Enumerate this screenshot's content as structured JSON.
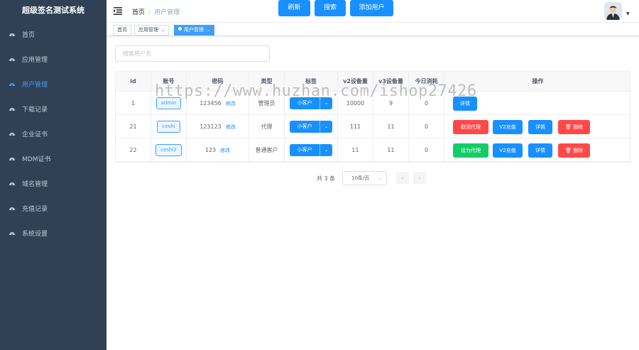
{
  "app": {
    "title": "超级签名测试系统"
  },
  "sidebar": {
    "items": [
      {
        "label": "首页",
        "icon": "dashboard-icon",
        "active": false
      },
      {
        "label": "应用管理",
        "icon": "dashboard-icon",
        "active": false
      },
      {
        "label": "用户管理",
        "icon": "dashboard-icon",
        "active": true
      },
      {
        "label": "下载记录",
        "icon": "dashboard-icon",
        "active": false
      },
      {
        "label": "企业证书",
        "icon": "dashboard-icon",
        "active": false
      },
      {
        "label": "MDM证书",
        "icon": "dashboard-icon",
        "active": false
      },
      {
        "label": "域名管理",
        "icon": "dashboard-icon",
        "active": false
      },
      {
        "label": "充值记录",
        "icon": "dashboard-icon",
        "active": false
      },
      {
        "label": "系统设置",
        "icon": "dashboard-icon",
        "active": false
      }
    ]
  },
  "header": {
    "breadcrumb": {
      "home": "首页",
      "separator": "/",
      "current": "用户管理"
    }
  },
  "tags": [
    {
      "label": "首页",
      "active": false
    },
    {
      "label": "应用管理",
      "active": false
    },
    {
      "label": "用户管理",
      "active": true
    }
  ],
  "toolbar": {
    "search_placeholder": "搜索用户名",
    "refresh_label": "刷新",
    "search_label": "搜索",
    "add_user_label": "添加用户"
  },
  "table": {
    "columns": [
      "id",
      "账号",
      "密码",
      "类型",
      "标签",
      "v2设备量",
      "v3设备量",
      "今日消耗",
      "操作"
    ],
    "modify_label": "修改",
    "rows": [
      {
        "id": "1",
        "account": "admin",
        "password": "123456",
        "type": "管理员",
        "tag": "小客户",
        "v2": "10000",
        "v3": "9",
        "today": "0",
        "actions": [
          "详情"
        ]
      },
      {
        "id": "21",
        "account": "ceshi",
        "password": "123123",
        "type": "代理",
        "tag": "小客户",
        "v2": "111",
        "v3": "11",
        "today": "0",
        "actions": [
          "取消代理",
          "V2充值",
          "详情",
          "删除"
        ]
      },
      {
        "id": "22",
        "account": "ceshi2",
        "password": "123",
        "type": "普通客户",
        "tag": "小客户",
        "v2": "11",
        "v3": "11",
        "today": "0",
        "actions": [
          "设为代理",
          "V2充值",
          "详情",
          "删除"
        ]
      }
    ]
  },
  "pagination": {
    "total_text": "共 3 条",
    "page_size": "10条/页",
    "prev": "‹",
    "next": "›"
  },
  "watermark": "https://www.huzhan.com/ishop27426",
  "colors": {
    "sidebar_bg": "#304156",
    "primary": "#1890ff",
    "danger": "#ff4949",
    "success": "#13ce66"
  }
}
